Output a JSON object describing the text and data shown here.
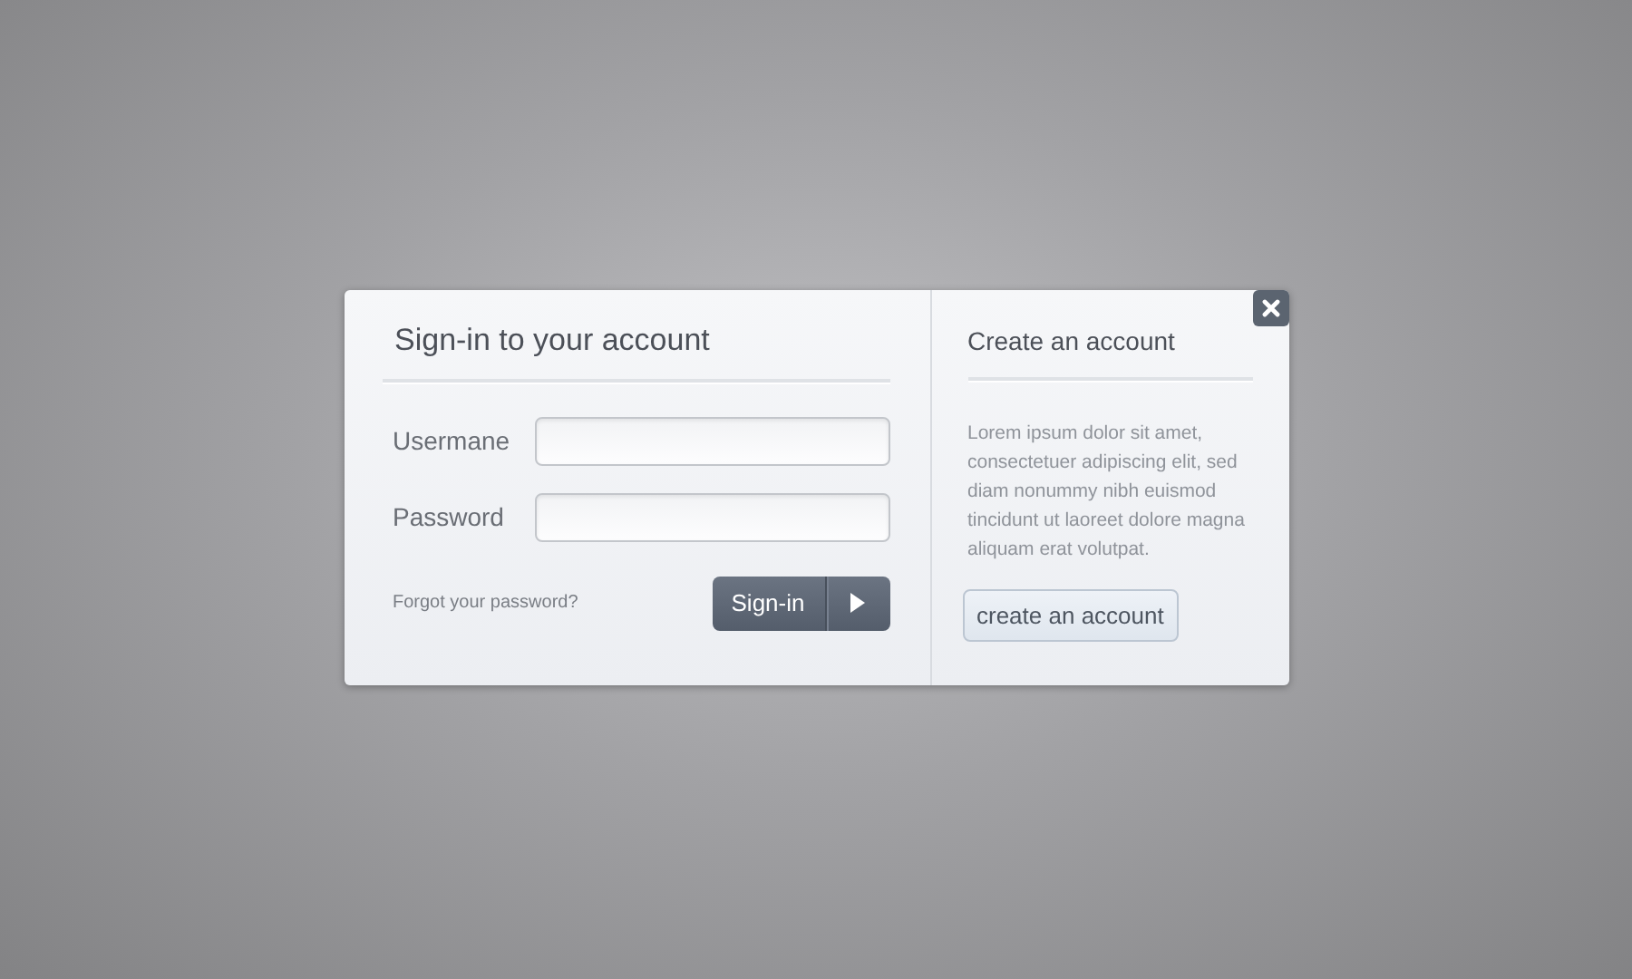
{
  "signin": {
    "title": "Sign-in to your account",
    "fields": [
      {
        "label": "Usermane"
      },
      {
        "label": "Password"
      }
    ],
    "forgot_link": "Forgot your password?",
    "button": "Sign-in"
  },
  "create": {
    "title": "Create an account",
    "text": "Lorem ipsum dolor sit amet, consectetuer adipiscing elit, sed diam nonummy nibh euismod tincidunt ut laoreet dolore magna aliquam erat volutpat.",
    "button": "create an account"
  }
}
